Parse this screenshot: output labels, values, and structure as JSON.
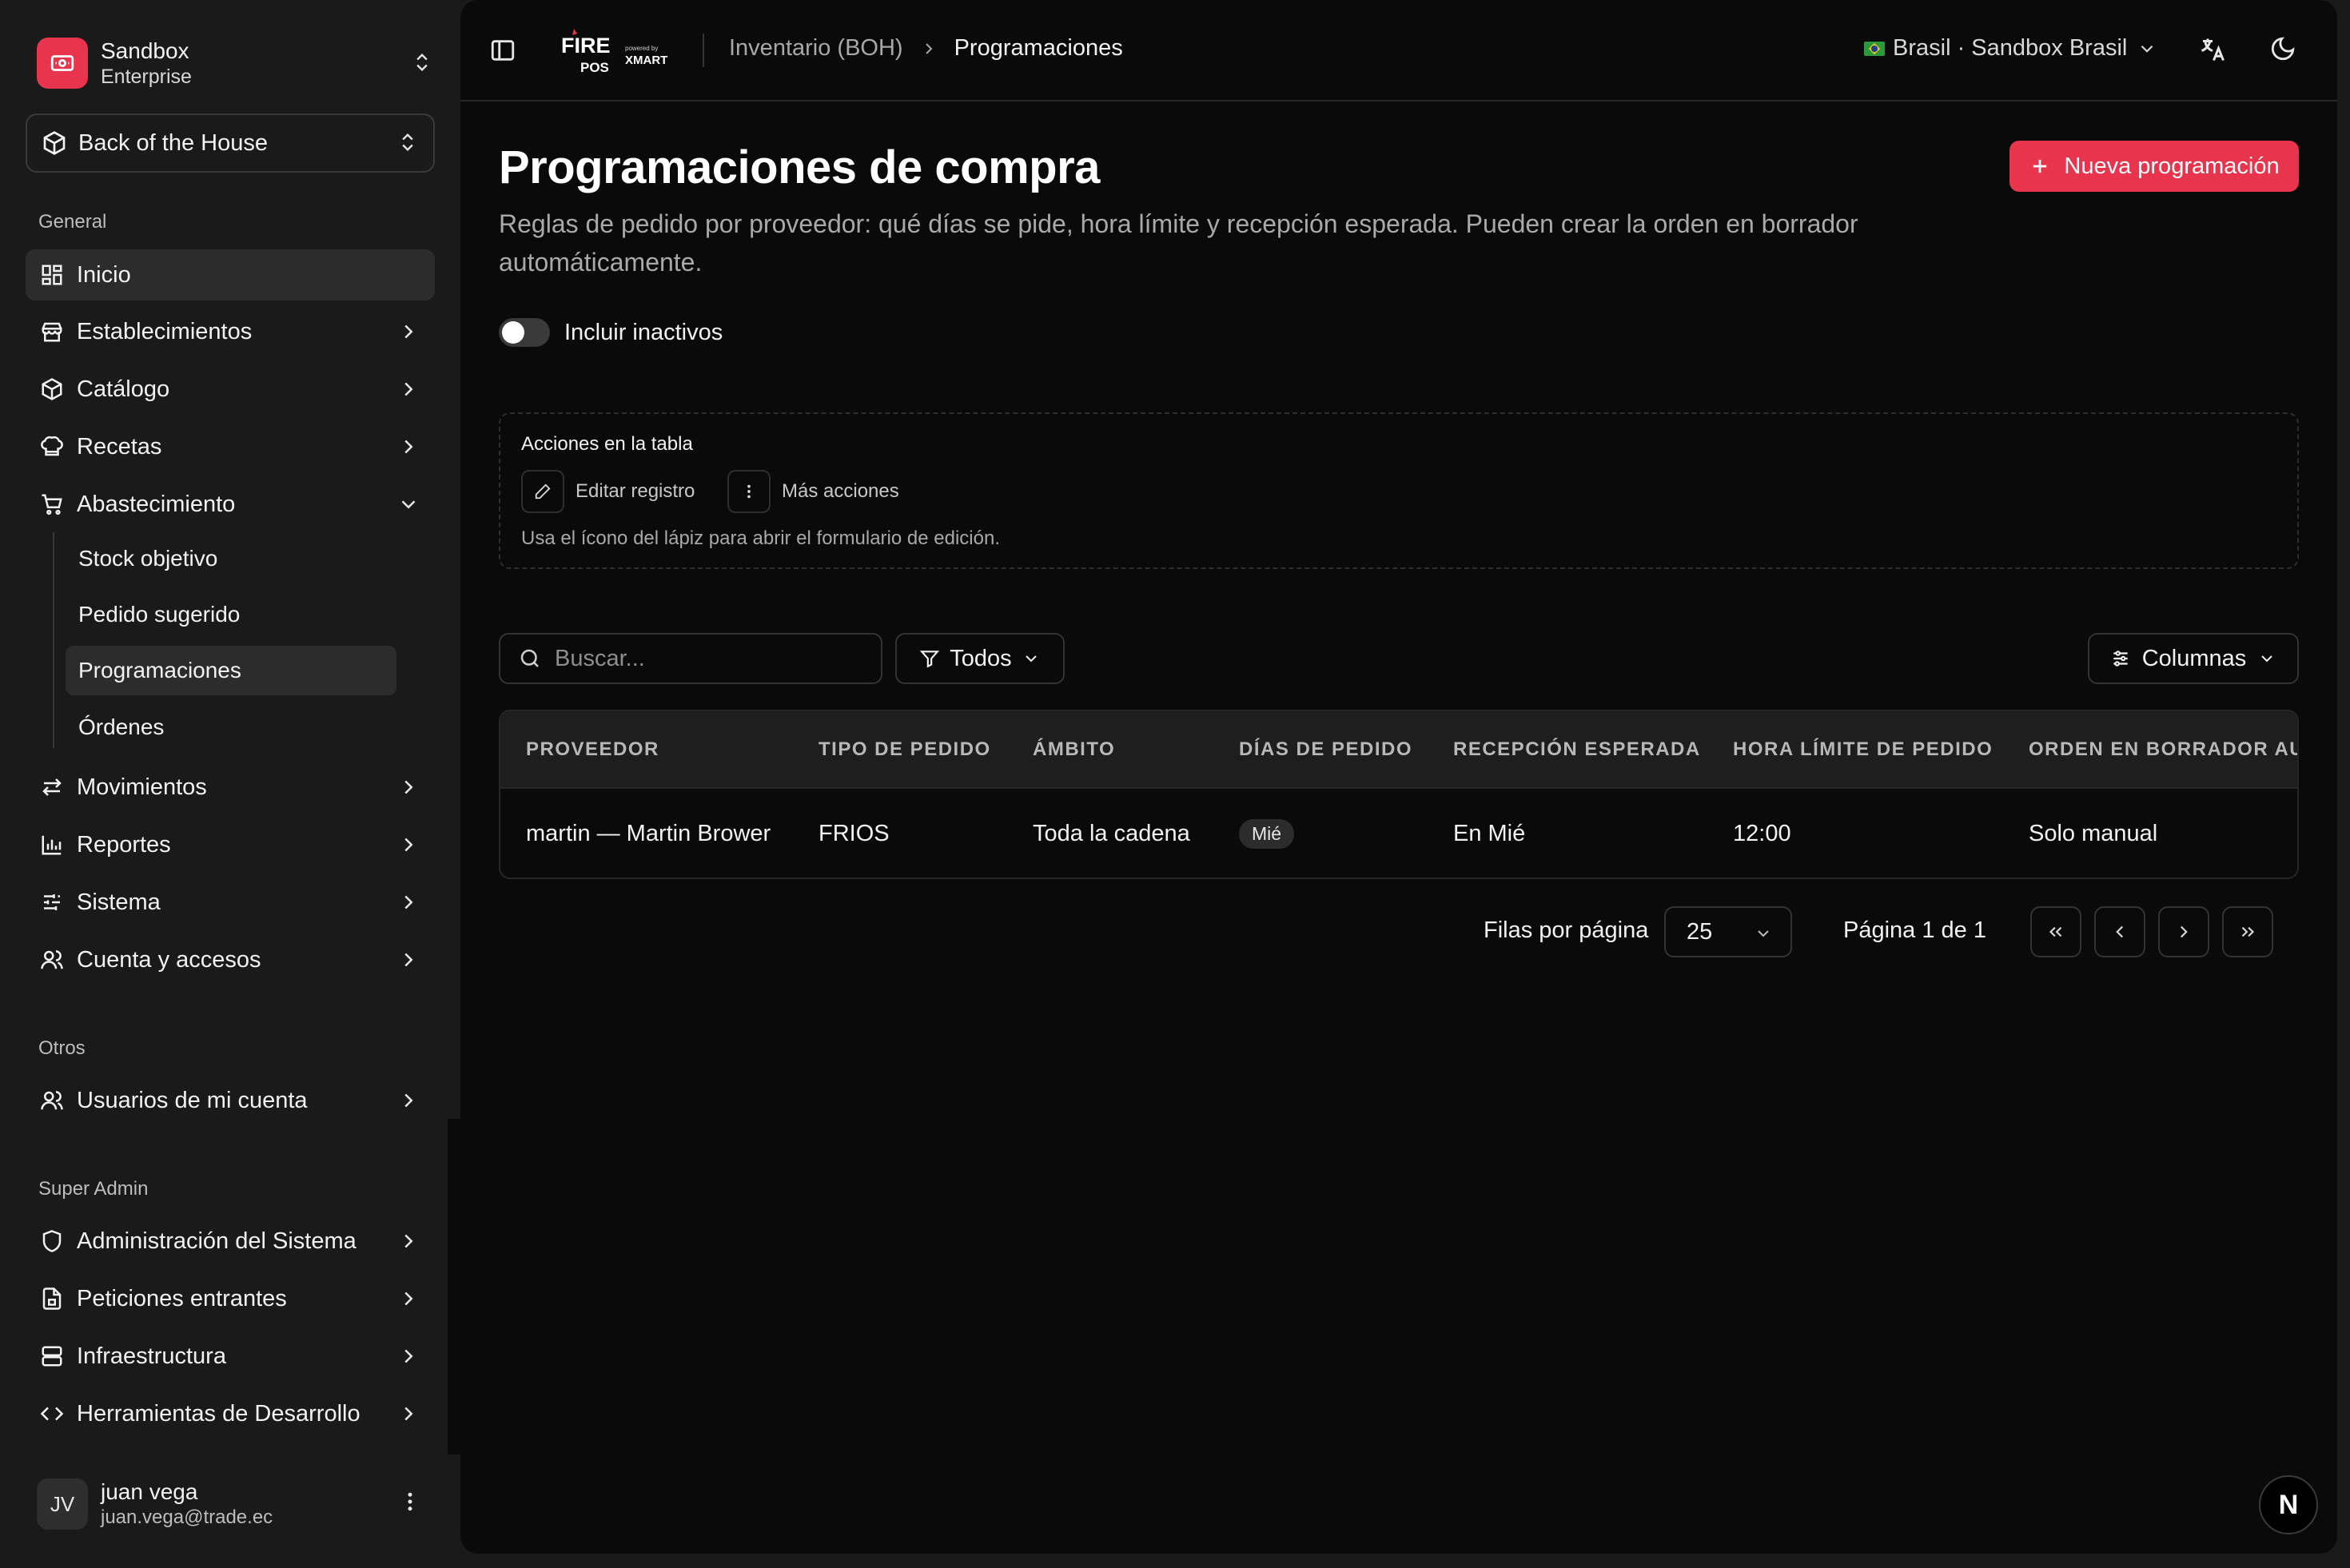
{
  "team": {
    "name": "Sandbox",
    "plan": "Enterprise"
  },
  "store_selector": {
    "label": "Back of the House"
  },
  "sidebar": {
    "general_label": "General",
    "items": [
      {
        "label": "Inicio"
      },
      {
        "label": "Establecimientos"
      },
      {
        "label": "Catálogo"
      },
      {
        "label": "Recetas"
      },
      {
        "label": "Abastecimiento"
      },
      {
        "label": "Movimientos"
      },
      {
        "label": "Reportes"
      },
      {
        "label": "Sistema"
      },
      {
        "label": "Cuenta y accesos"
      }
    ],
    "sub_items": [
      {
        "label": "Stock objetivo"
      },
      {
        "label": "Pedido sugerido"
      },
      {
        "label": "Programaciones"
      },
      {
        "label": "Órdenes"
      }
    ],
    "otros_label": "Otros",
    "otros_items": [
      {
        "label": "Usuarios de mi cuenta"
      }
    ],
    "superadmin_label": "Super Admin",
    "superadmin_items": [
      {
        "label": "Administración del Sistema"
      },
      {
        "label": "Peticiones entrantes"
      },
      {
        "label": "Infraestructura"
      },
      {
        "label": "Herramientas de Desarrollo"
      }
    ]
  },
  "user": {
    "initials": "JV",
    "name": "juan vega",
    "email": "juan.vega@trade.ec"
  },
  "topbar": {
    "brand_top": "FIRE",
    "brand_bottom": "POS",
    "brand_powered": "powered by",
    "brand_partner": "XMART",
    "breadcrumb": [
      "Inventario (BOH)",
      "Programaciones"
    ],
    "region": "Brasil · Sandbox Brasil"
  },
  "page": {
    "title": "Programaciones de compra",
    "description": "Reglas de pedido por proveedor: qué días se pide, hora límite y recepción esperada. Pueden crear la orden en borrador automáticamente.",
    "new_button": "Nueva programación",
    "toggle_label": "Incluir inactivos"
  },
  "actions_box": {
    "title": "Acciones en la tabla",
    "edit_label": "Editar registro",
    "more_label": "Más acciones",
    "hint": "Usa el ícono del lápiz para abrir el formulario de edición."
  },
  "toolbar": {
    "search_placeholder": "Buscar...",
    "filter_label": "Todos",
    "columns_label": "Columnas"
  },
  "table": {
    "headers": [
      "PROVEEDOR",
      "TIPO DE PEDIDO",
      "ÁMBITO",
      "DÍAS DE PEDIDO",
      "RECEPCIÓN ESPERADA",
      "HORA LÍMITE DE PEDIDO",
      "ORDEN EN BORRADOR AUTOMÁTICA"
    ],
    "rows": [
      {
        "proveedor": "martin — Martin Brower",
        "tipo": "FRIOS",
        "ambito": "Toda la cadena",
        "dias": "Mié",
        "recepcion": "En Mié",
        "hora": "12:00",
        "borrador": "Solo manual"
      }
    ]
  },
  "pagination": {
    "rows_label": "Filas por página",
    "rows_value": "25",
    "page_info": "Página 1 de 1"
  },
  "fab": {
    "label": "N"
  },
  "colors": {
    "accent": "#e8344c",
    "sidebar_bg": "#1a1a1a",
    "main_bg": "#0a0a0a"
  }
}
